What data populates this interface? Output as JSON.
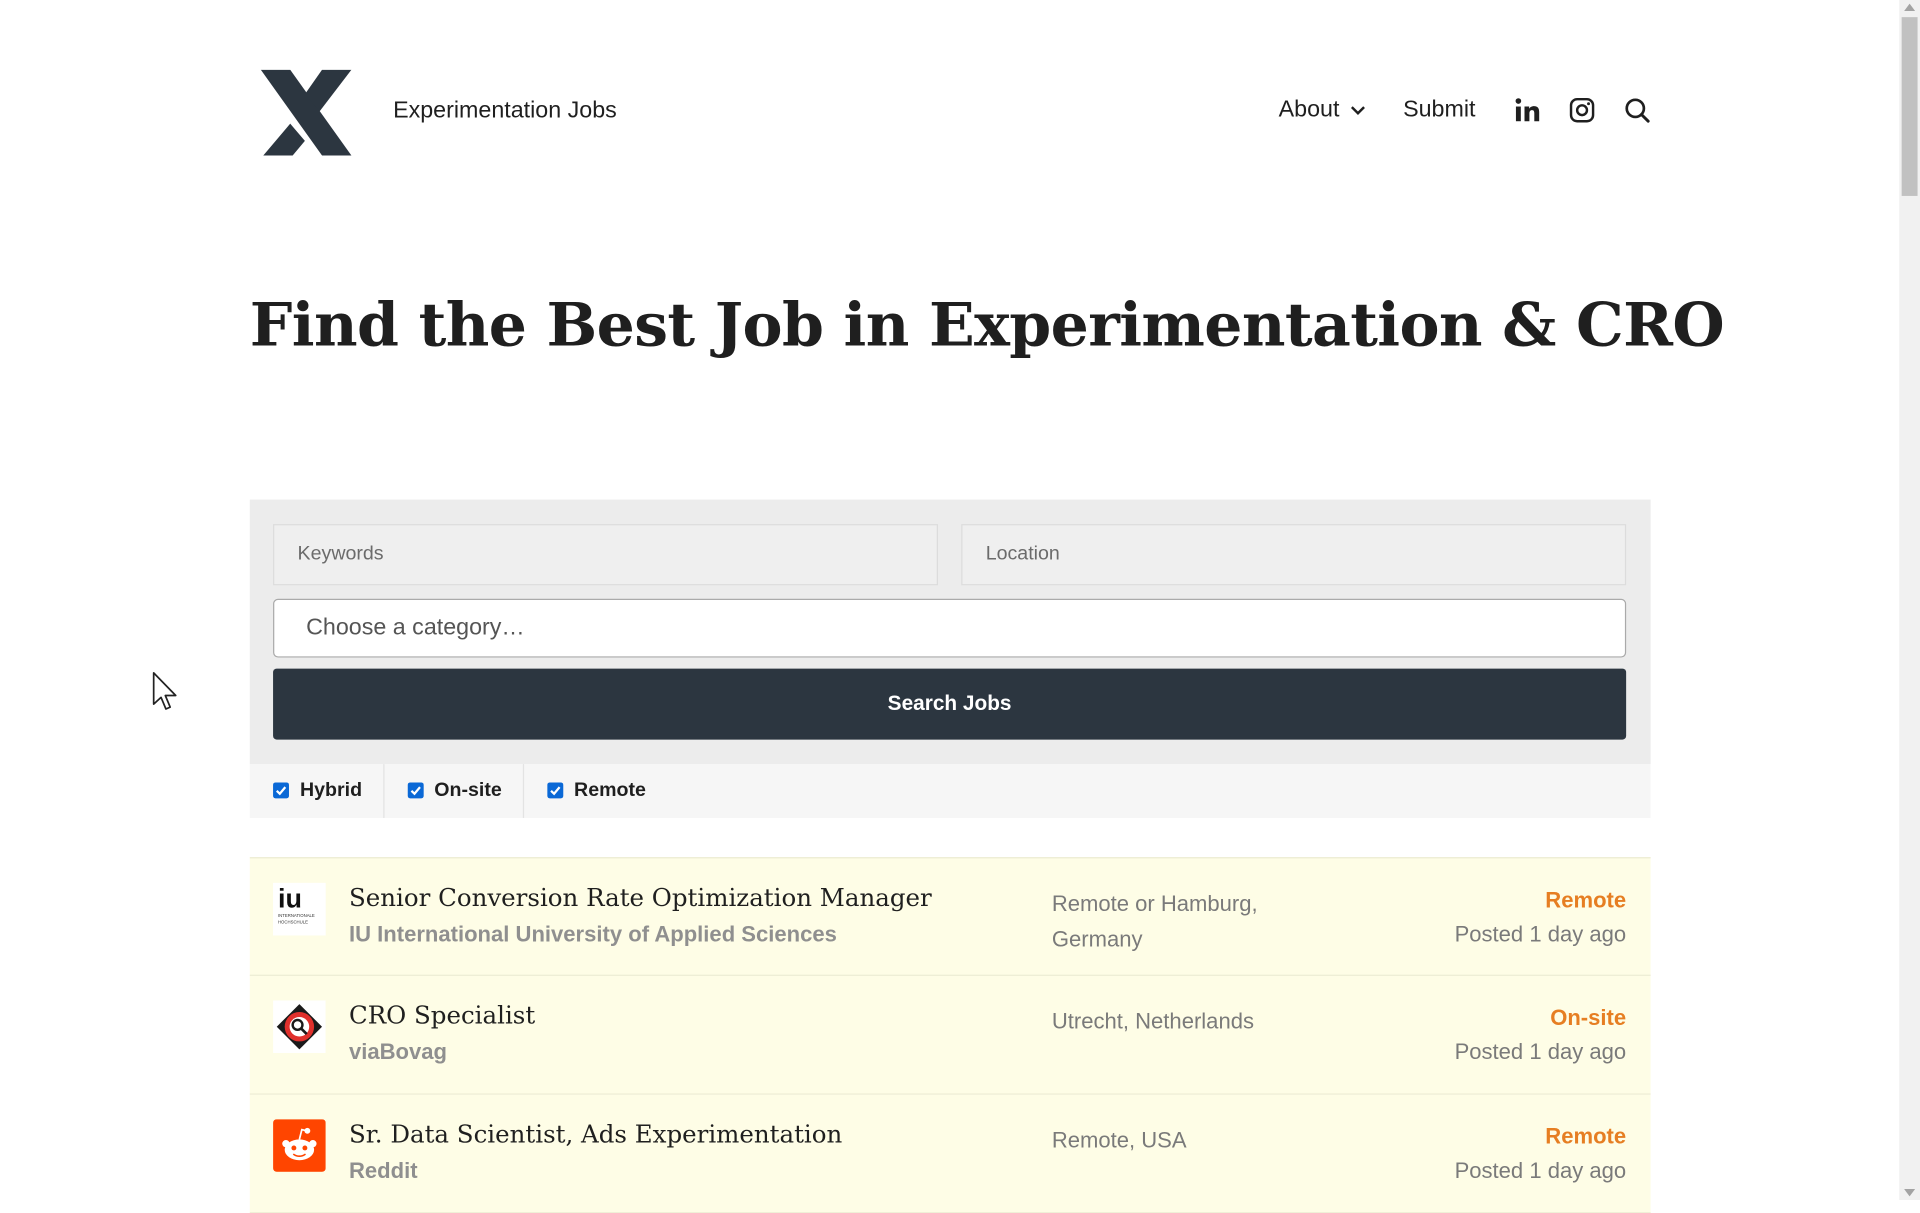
{
  "header": {
    "site_title": "Experimentation Jobs",
    "nav": {
      "about": "About",
      "submit": "Submit"
    },
    "icons": [
      "linkedin-icon",
      "instagram-icon",
      "search-icon"
    ]
  },
  "hero": {
    "title": "Find the Best Job in Experimentation & CRO"
  },
  "search": {
    "keywords_placeholder": "Keywords",
    "location_placeholder": "Location",
    "category_placeholder": "Choose a category…",
    "button_label": "Search Jobs"
  },
  "filters": [
    {
      "label": "Hybrid",
      "checked": true
    },
    {
      "label": "On-site",
      "checked": true
    },
    {
      "label": "Remote",
      "checked": true
    }
  ],
  "jobs": [
    {
      "title": "Senior Conversion Rate Optimization Manager",
      "company": "IU International University of Applied Sciences",
      "location": "Remote or Hamburg, Germany",
      "type": "Remote",
      "posted": "Posted 1 day ago",
      "logo_text": "iu",
      "logo_subtext": "INTERNATIONALE HOCHSCHULE"
    },
    {
      "title": "CRO Specialist",
      "company": "viaBovag",
      "location": "Utrecht, Netherlands",
      "type": "On-site",
      "posted": "Posted 1 day ago"
    },
    {
      "title": "Sr. Data Scientist, Ads Experimentation",
      "company": "Reddit",
      "location": "Remote, USA",
      "type": "Remote",
      "posted": "Posted 1 day ago"
    }
  ],
  "colors": {
    "accent_orange": "#e67e22",
    "button_dark": "#2c3640",
    "checkbox_blue": "#0a68d6",
    "listing_bg": "#fefde6",
    "reddit_orange": "#ff4500"
  }
}
